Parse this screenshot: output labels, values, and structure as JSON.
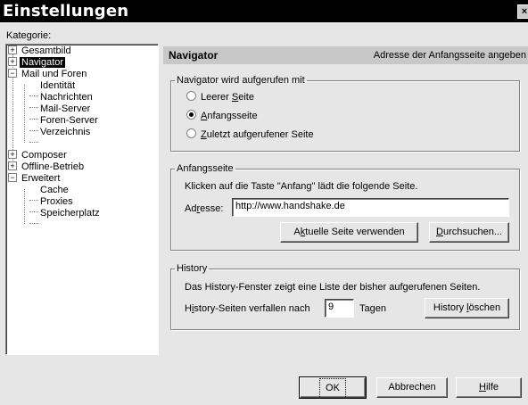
{
  "window": {
    "title": "Einstellungen",
    "close_glyph": "×"
  },
  "category_label": "Kategorie:",
  "tree": [
    {
      "label": "Gesamtbild",
      "expander": "+"
    },
    {
      "label": "Navigator",
      "expander": "+",
      "selected": true
    },
    {
      "label": "Mail und Foren",
      "expander": "−"
    },
    {
      "label": "Identität"
    },
    {
      "label": "Nachrichten"
    },
    {
      "label": "Mail-Server"
    },
    {
      "label": "Foren-Server"
    },
    {
      "label": "Verzeichnis"
    },
    {
      "label": "Composer",
      "expander": "+"
    },
    {
      "label": "Offline-Betrieb",
      "expander": "+"
    },
    {
      "label": "Erweitert",
      "expander": "−"
    },
    {
      "label": "Cache"
    },
    {
      "label": "Proxies"
    },
    {
      "label": "Speicherplatz"
    }
  ],
  "panel": {
    "title": "Navigator",
    "description": "Adresse der Anfangsseite angeben"
  },
  "start_group": {
    "legend": "Navigator wird aufgerufen mit",
    "options": [
      {
        "pre": "Leerer ",
        "ul": "S",
        "post": "eite",
        "checked": false
      },
      {
        "pre": "",
        "ul": "A",
        "post": "nfangsseite",
        "checked": true
      },
      {
        "pre": "",
        "ul": "Z",
        "post": "uletzt aufgerufener Seite",
        "checked": false
      }
    ]
  },
  "home_group": {
    "legend": "Anfangsseite",
    "info": "Klicken auf die Taste \"Anfang\" lädt die folgende Seite.",
    "address_pre": "Ad",
    "address_ul": "r",
    "address_post": "esse:",
    "address_value": "http://www.handshake.de",
    "use_current_pre": "A",
    "use_current_ul": "k",
    "use_current_post": "tuelle Seite verwenden",
    "browse_ul": "D",
    "browse_post": "urchsuchen..."
  },
  "history_group": {
    "legend": "History",
    "info": "Das History-Fenster zeigt eine Liste der bisher aufgerufenen Seiten.",
    "expire_pre": "H",
    "expire_ul": "i",
    "expire_post": "story-Seiten verfallen nach",
    "days_value": "9",
    "days_unit": "Tagen",
    "clear_pre": "History ",
    "clear_ul": "l",
    "clear_post": "öschen"
  },
  "footer": {
    "ok": "OK",
    "cancel": "Abbrechen",
    "help_ul": "H",
    "help_post": "ilfe"
  }
}
